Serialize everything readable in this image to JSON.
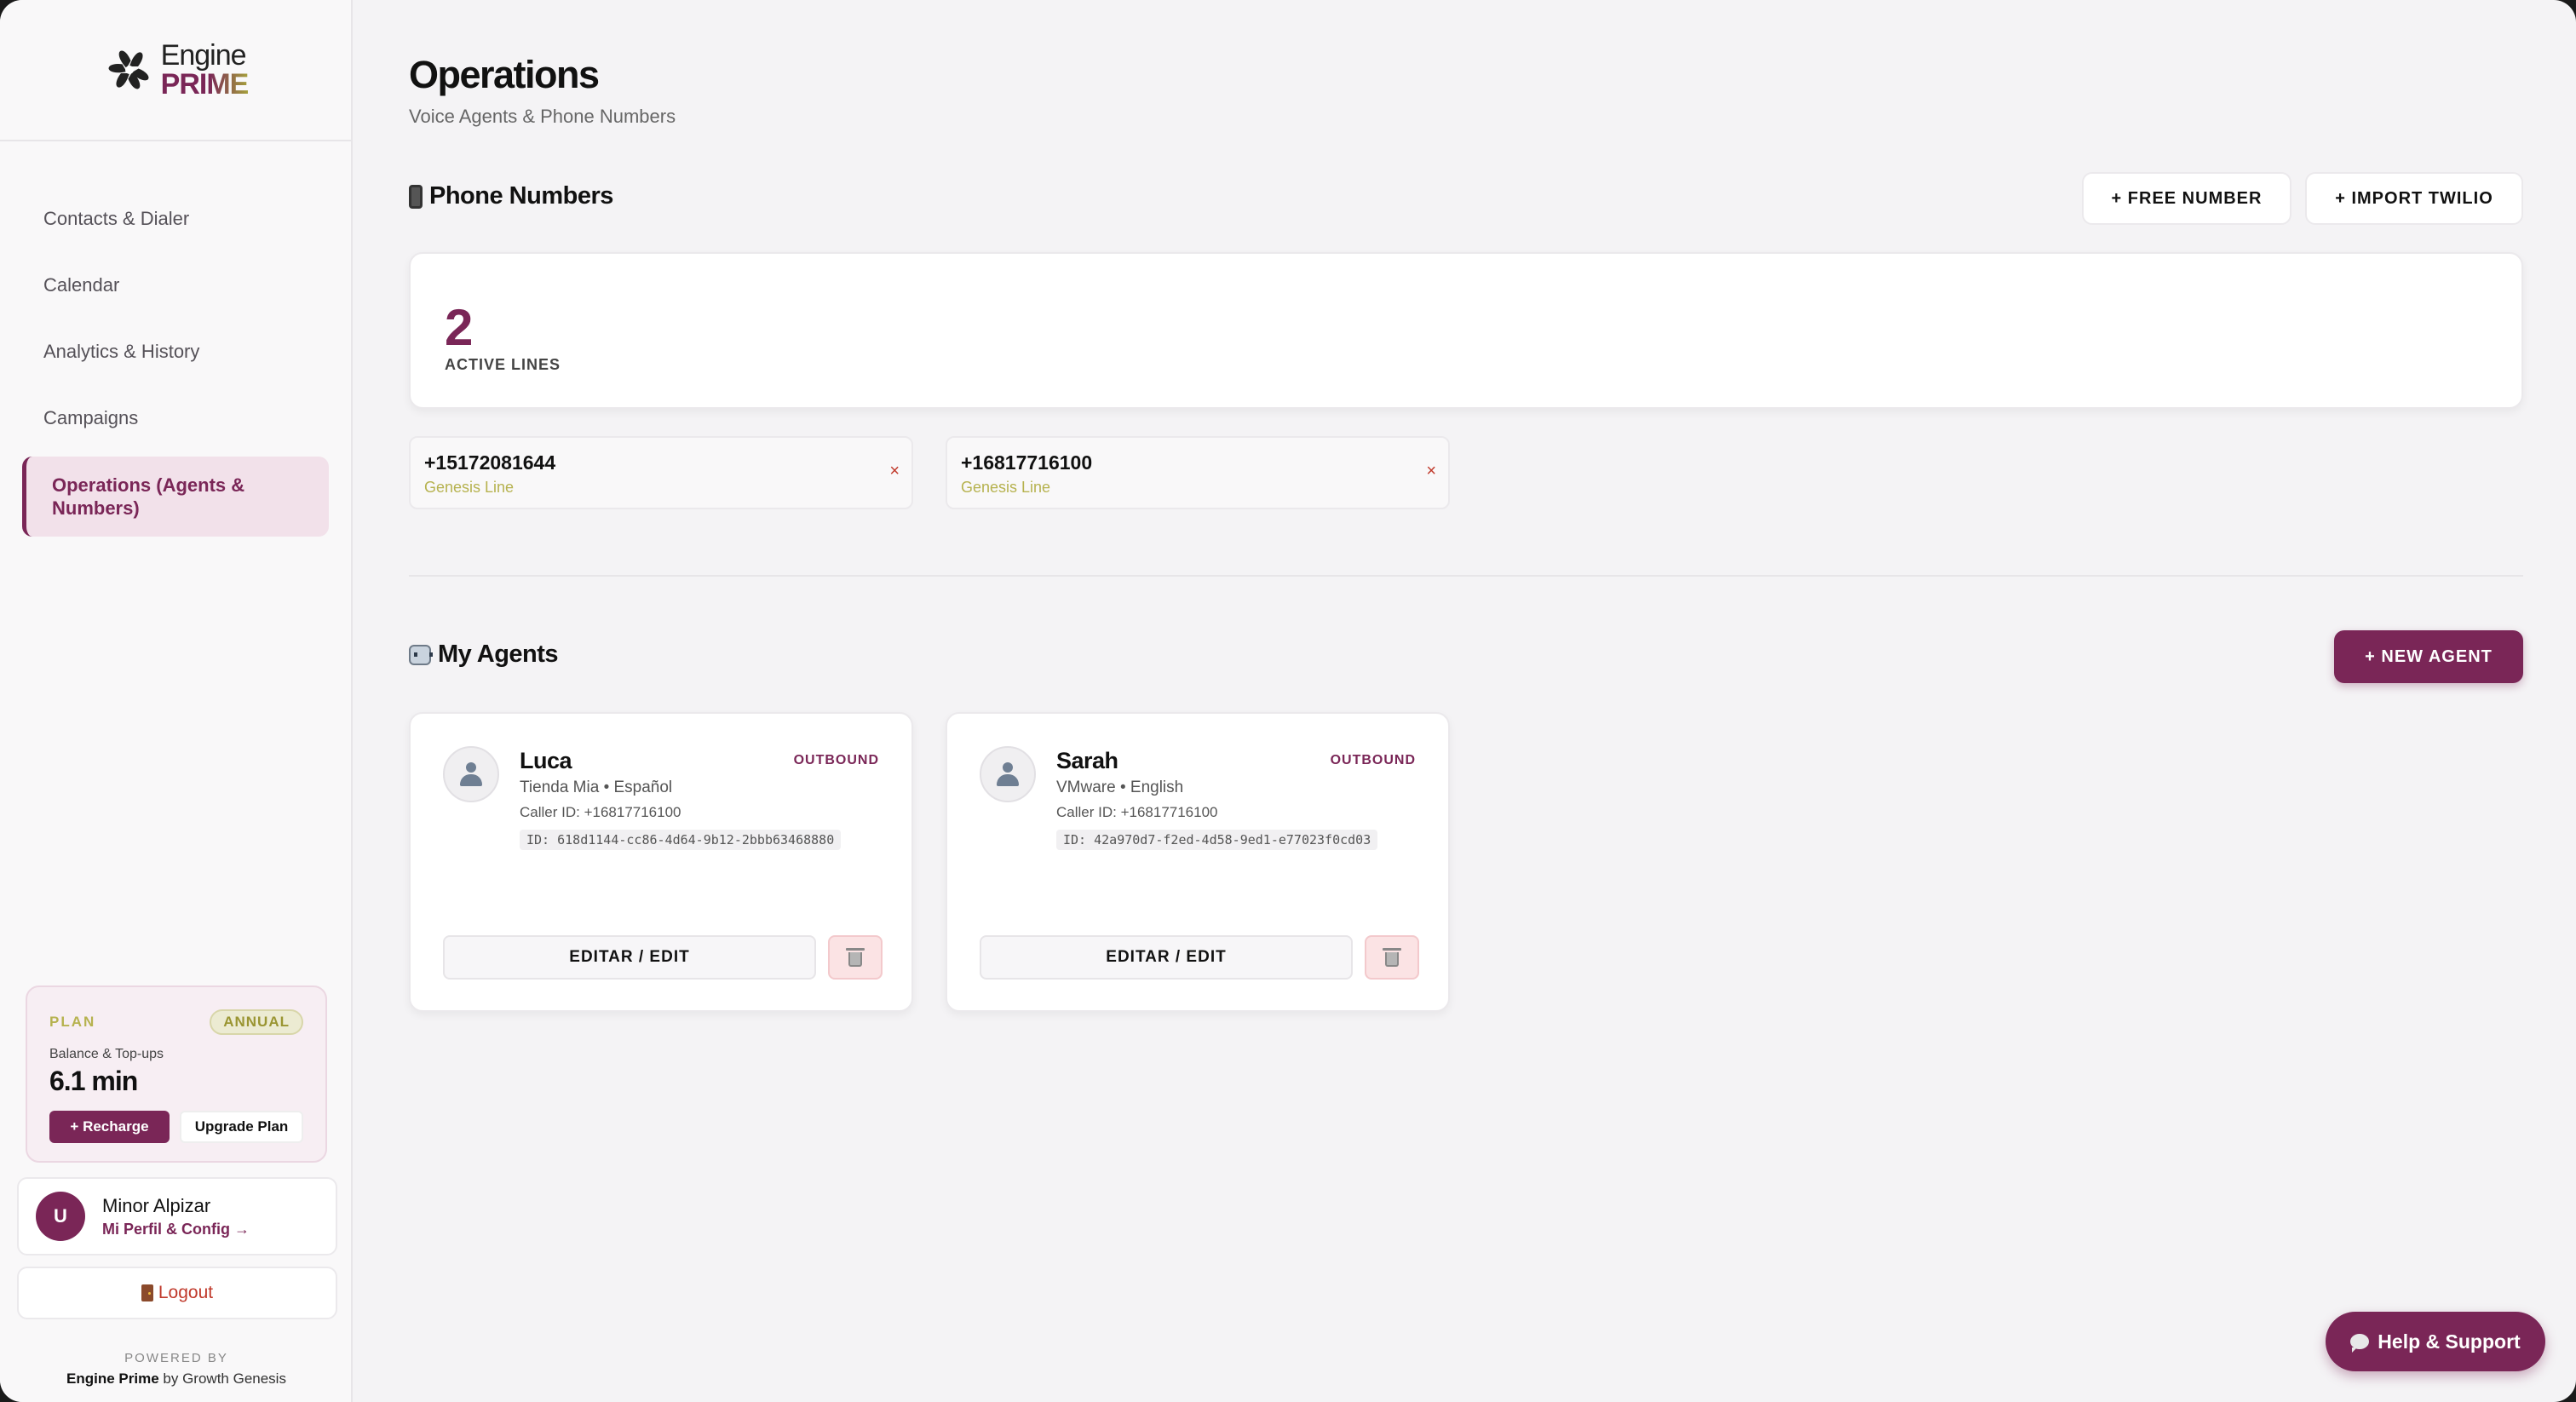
{
  "brand": {
    "name_top": "Engine",
    "name_bottom": "PRIME"
  },
  "sidebar": {
    "items": [
      {
        "label": "Contacts & Dialer"
      },
      {
        "label": "Calendar"
      },
      {
        "label": "Analytics & History"
      },
      {
        "label": "Campaigns"
      },
      {
        "label": "Operations (Agents & Numbers)",
        "active": true
      }
    ],
    "plan": {
      "label": "PLAN",
      "badge": "ANNUAL",
      "balance_label": "Balance & Top-ups",
      "balance_value": "6.1 min",
      "recharge_label": "+ Recharge",
      "upgrade_label": "Upgrade Plan"
    },
    "user": {
      "initial": "U",
      "name": "Minor Alpizar",
      "profile_link": "Mi Perfil & Config →"
    },
    "logout_label": "Logout",
    "powered_by": "POWERED BY",
    "powered_brand": "Engine Prime",
    "powered_suffix": " by Growth Genesis"
  },
  "main": {
    "title": "Operations",
    "subtitle": "Voice Agents & Phone Numbers",
    "phone_section": {
      "title": "Phone Numbers",
      "free_number_label": "+ FREE NUMBER",
      "import_twilio_label": "+ IMPORT TWILIO",
      "active_count": "2",
      "active_label": "ACTIVE LINES",
      "numbers": [
        {
          "number": "+15172081644",
          "type": "Genesis Line",
          "remove": "×"
        },
        {
          "number": "+16817716100",
          "type": "Genesis Line",
          "remove": "×"
        }
      ]
    },
    "agents_section": {
      "title": "My Agents",
      "new_agent_label": "+ NEW AGENT",
      "agents": [
        {
          "name": "Luca",
          "direction": "OUTBOUND",
          "meta": "Tienda Mia • Español",
          "caller_id": "Caller ID: +16817716100",
          "id": "ID: 618d1144-cc86-4d64-9b12-2bbb63468880",
          "edit_label": "EDITAR / EDIT"
        },
        {
          "name": "Sarah",
          "direction": "OUTBOUND",
          "meta": "VMware • English",
          "caller_id": "Caller ID: +16817716100",
          "id": "ID: 42a970d7-f2ed-4d58-9ed1-e77023f0cd03",
          "edit_label": "EDITAR / EDIT"
        }
      ]
    }
  },
  "help_label": "Help & Support",
  "colors": {
    "accent": "#7a2657",
    "gold": "#b6b24f",
    "danger": "#c0392b"
  }
}
